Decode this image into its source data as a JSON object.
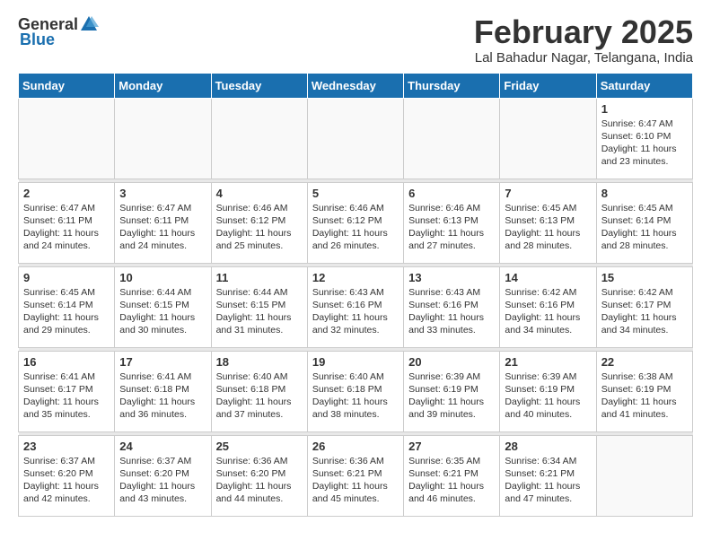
{
  "header": {
    "logo_general": "General",
    "logo_blue": "Blue",
    "month_title": "February 2025",
    "subtitle": "Lal Bahadur Nagar, Telangana, India"
  },
  "weekdays": [
    "Sunday",
    "Monday",
    "Tuesday",
    "Wednesday",
    "Thursday",
    "Friday",
    "Saturday"
  ],
  "weeks": [
    [
      {
        "day": "",
        "info": ""
      },
      {
        "day": "",
        "info": ""
      },
      {
        "day": "",
        "info": ""
      },
      {
        "day": "",
        "info": ""
      },
      {
        "day": "",
        "info": ""
      },
      {
        "day": "",
        "info": ""
      },
      {
        "day": "1",
        "info": "Sunrise: 6:47 AM\nSunset: 6:10 PM\nDaylight: 11 hours and 23 minutes."
      }
    ],
    [
      {
        "day": "2",
        "info": "Sunrise: 6:47 AM\nSunset: 6:11 PM\nDaylight: 11 hours and 24 minutes."
      },
      {
        "day": "3",
        "info": "Sunrise: 6:47 AM\nSunset: 6:11 PM\nDaylight: 11 hours and 24 minutes."
      },
      {
        "day": "4",
        "info": "Sunrise: 6:46 AM\nSunset: 6:12 PM\nDaylight: 11 hours and 25 minutes."
      },
      {
        "day": "5",
        "info": "Sunrise: 6:46 AM\nSunset: 6:12 PM\nDaylight: 11 hours and 26 minutes."
      },
      {
        "day": "6",
        "info": "Sunrise: 6:46 AM\nSunset: 6:13 PM\nDaylight: 11 hours and 27 minutes."
      },
      {
        "day": "7",
        "info": "Sunrise: 6:45 AM\nSunset: 6:13 PM\nDaylight: 11 hours and 28 minutes."
      },
      {
        "day": "8",
        "info": "Sunrise: 6:45 AM\nSunset: 6:14 PM\nDaylight: 11 hours and 28 minutes."
      }
    ],
    [
      {
        "day": "9",
        "info": "Sunrise: 6:45 AM\nSunset: 6:14 PM\nDaylight: 11 hours and 29 minutes."
      },
      {
        "day": "10",
        "info": "Sunrise: 6:44 AM\nSunset: 6:15 PM\nDaylight: 11 hours and 30 minutes."
      },
      {
        "day": "11",
        "info": "Sunrise: 6:44 AM\nSunset: 6:15 PM\nDaylight: 11 hours and 31 minutes."
      },
      {
        "day": "12",
        "info": "Sunrise: 6:43 AM\nSunset: 6:16 PM\nDaylight: 11 hours and 32 minutes."
      },
      {
        "day": "13",
        "info": "Sunrise: 6:43 AM\nSunset: 6:16 PM\nDaylight: 11 hours and 33 minutes."
      },
      {
        "day": "14",
        "info": "Sunrise: 6:42 AM\nSunset: 6:16 PM\nDaylight: 11 hours and 34 minutes."
      },
      {
        "day": "15",
        "info": "Sunrise: 6:42 AM\nSunset: 6:17 PM\nDaylight: 11 hours and 34 minutes."
      }
    ],
    [
      {
        "day": "16",
        "info": "Sunrise: 6:41 AM\nSunset: 6:17 PM\nDaylight: 11 hours and 35 minutes."
      },
      {
        "day": "17",
        "info": "Sunrise: 6:41 AM\nSunset: 6:18 PM\nDaylight: 11 hours and 36 minutes."
      },
      {
        "day": "18",
        "info": "Sunrise: 6:40 AM\nSunset: 6:18 PM\nDaylight: 11 hours and 37 minutes."
      },
      {
        "day": "19",
        "info": "Sunrise: 6:40 AM\nSunset: 6:18 PM\nDaylight: 11 hours and 38 minutes."
      },
      {
        "day": "20",
        "info": "Sunrise: 6:39 AM\nSunset: 6:19 PM\nDaylight: 11 hours and 39 minutes."
      },
      {
        "day": "21",
        "info": "Sunrise: 6:39 AM\nSunset: 6:19 PM\nDaylight: 11 hours and 40 minutes."
      },
      {
        "day": "22",
        "info": "Sunrise: 6:38 AM\nSunset: 6:19 PM\nDaylight: 11 hours and 41 minutes."
      }
    ],
    [
      {
        "day": "23",
        "info": "Sunrise: 6:37 AM\nSunset: 6:20 PM\nDaylight: 11 hours and 42 minutes."
      },
      {
        "day": "24",
        "info": "Sunrise: 6:37 AM\nSunset: 6:20 PM\nDaylight: 11 hours and 43 minutes."
      },
      {
        "day": "25",
        "info": "Sunrise: 6:36 AM\nSunset: 6:20 PM\nDaylight: 11 hours and 44 minutes."
      },
      {
        "day": "26",
        "info": "Sunrise: 6:36 AM\nSunset: 6:21 PM\nDaylight: 11 hours and 45 minutes."
      },
      {
        "day": "27",
        "info": "Sunrise: 6:35 AM\nSunset: 6:21 PM\nDaylight: 11 hours and 46 minutes."
      },
      {
        "day": "28",
        "info": "Sunrise: 6:34 AM\nSunset: 6:21 PM\nDaylight: 11 hours and 47 minutes."
      },
      {
        "day": "",
        "info": ""
      }
    ]
  ]
}
